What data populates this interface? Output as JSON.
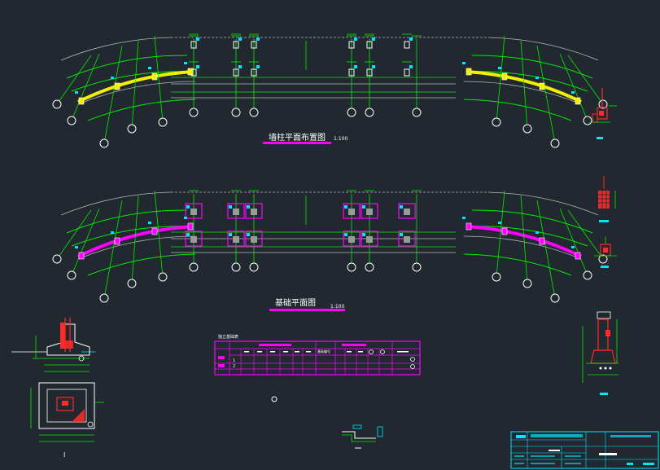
{
  "drawing": {
    "title_top": "墙柱平面布置图",
    "scale_top": "1:100",
    "title_bottom": "基础平面图",
    "scale_bottom": "1:100",
    "table_title": "独立基础表",
    "table_header_code": "基础编号",
    "table_row_labels": [
      "1",
      "2"
    ],
    "detail_mark": "I"
  },
  "colors": {
    "background": "#212830",
    "axis_green": "#00ee00",
    "gray_line": "#b8b8b8",
    "yellow_wall": "#f0f000",
    "magenta": "#ff00ff",
    "red": "#ff2a2a",
    "cyan": "#00e6ff",
    "white": "#ffffff"
  }
}
